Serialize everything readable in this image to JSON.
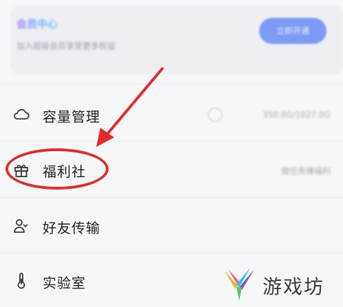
{
  "vip_card": {
    "title": "会员中心",
    "subtitle": "加入超级会员享受更多权益",
    "button_label": "立即开通"
  },
  "menu": {
    "items": [
      {
        "label": "容量管理",
        "icon": "cloud-icon",
        "right_text": "350.0G/1027.0G"
      },
      {
        "label": "福利社",
        "icon": "gift-icon",
        "right_text": "做任务赚福利"
      },
      {
        "label": "好友传输",
        "icon": "people-icon",
        "right_text": ""
      },
      {
        "label": "实验室",
        "icon": "thermometer-icon",
        "right_text": ""
      }
    ]
  },
  "highlight": {
    "color": "#e32a2a"
  },
  "watermark": {
    "text": "游戏坊"
  }
}
